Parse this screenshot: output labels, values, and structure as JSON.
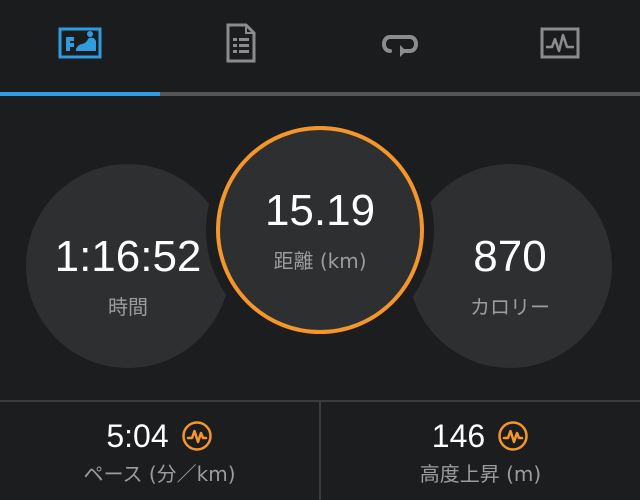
{
  "tabs": [
    {
      "icon": "activity-overview-icon",
      "active": true
    },
    {
      "icon": "details-list-icon",
      "active": false
    },
    {
      "icon": "laps-loop-icon",
      "active": false
    },
    {
      "icon": "chart-graph-icon",
      "active": false
    }
  ],
  "colors": {
    "active_tab": "#2f9be0",
    "ring_time_top": "#3b9fe0",
    "ring_time_bottom": "#9779b8",
    "ring_distance": "#f5962b",
    "ring_calories": "#33dd33",
    "badge": "#f5962b"
  },
  "stats": {
    "time": {
      "value": "1:16:52",
      "label": "時間"
    },
    "distance": {
      "value": "15.19",
      "label": "距離 (km)"
    },
    "calories": {
      "value": "870",
      "label": "カロリー"
    }
  },
  "metrics": {
    "pace": {
      "value": "5:04",
      "label": "ペース (分／km)",
      "badge_icon": "connect-iq-badge-icon"
    },
    "elevation": {
      "value": "146",
      "label": "高度上昇 (m)",
      "badge_icon": "connect-iq-badge-icon"
    }
  }
}
